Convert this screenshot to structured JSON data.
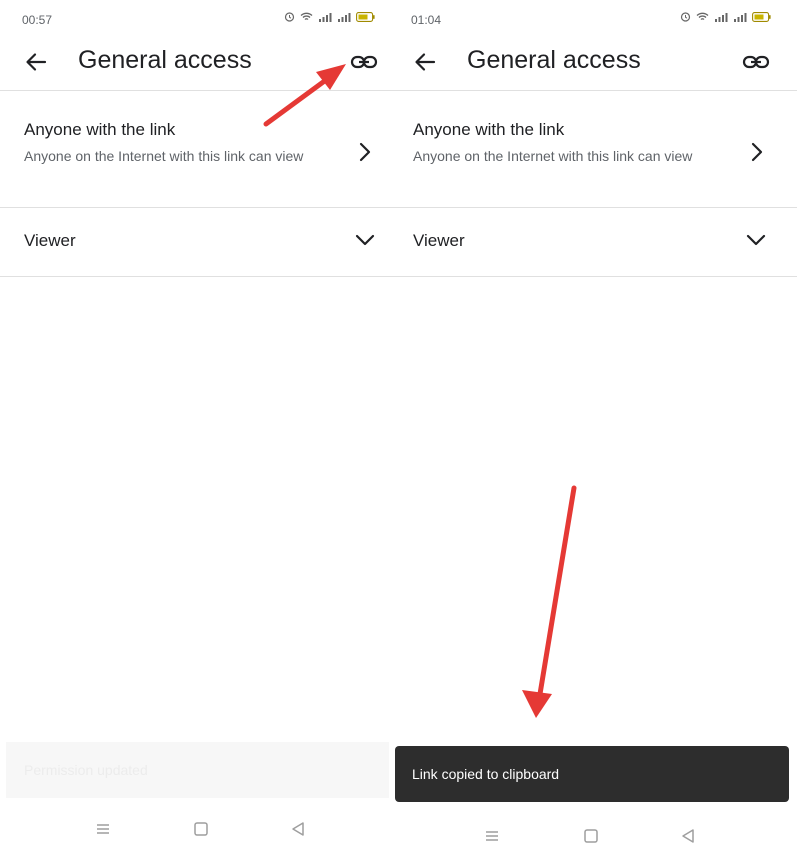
{
  "colors": {
    "annotation_arrow": "#e53935",
    "snackbar_background": "#2d2d2d",
    "divider": "#e0e0e0"
  },
  "left_screen": {
    "status_time": "00:57",
    "title": "General access",
    "access": {
      "title": "Anyone with the link",
      "description": "Anyone on the Internet with this link can view"
    },
    "role": "Viewer",
    "faded_snackbar": "Permission updated"
  },
  "right_screen": {
    "status_time": "01:04",
    "title": "General access",
    "access": {
      "title": "Anyone with the link",
      "description": "Anyone on the Internet with this link can view"
    },
    "role": "Viewer",
    "snackbar": "Link copied to clipboard"
  },
  "icons": {
    "status": [
      "alarm-icon",
      "wifi-icon",
      "signal-icon",
      "battery-icon"
    ],
    "app_bar": [
      "back-arrow-icon",
      "link-icon"
    ],
    "rows": [
      "chevron-right-icon",
      "chevron-down-icon"
    ],
    "nav": [
      "menu-icon",
      "home-square-icon",
      "back-triangle-icon"
    ]
  }
}
